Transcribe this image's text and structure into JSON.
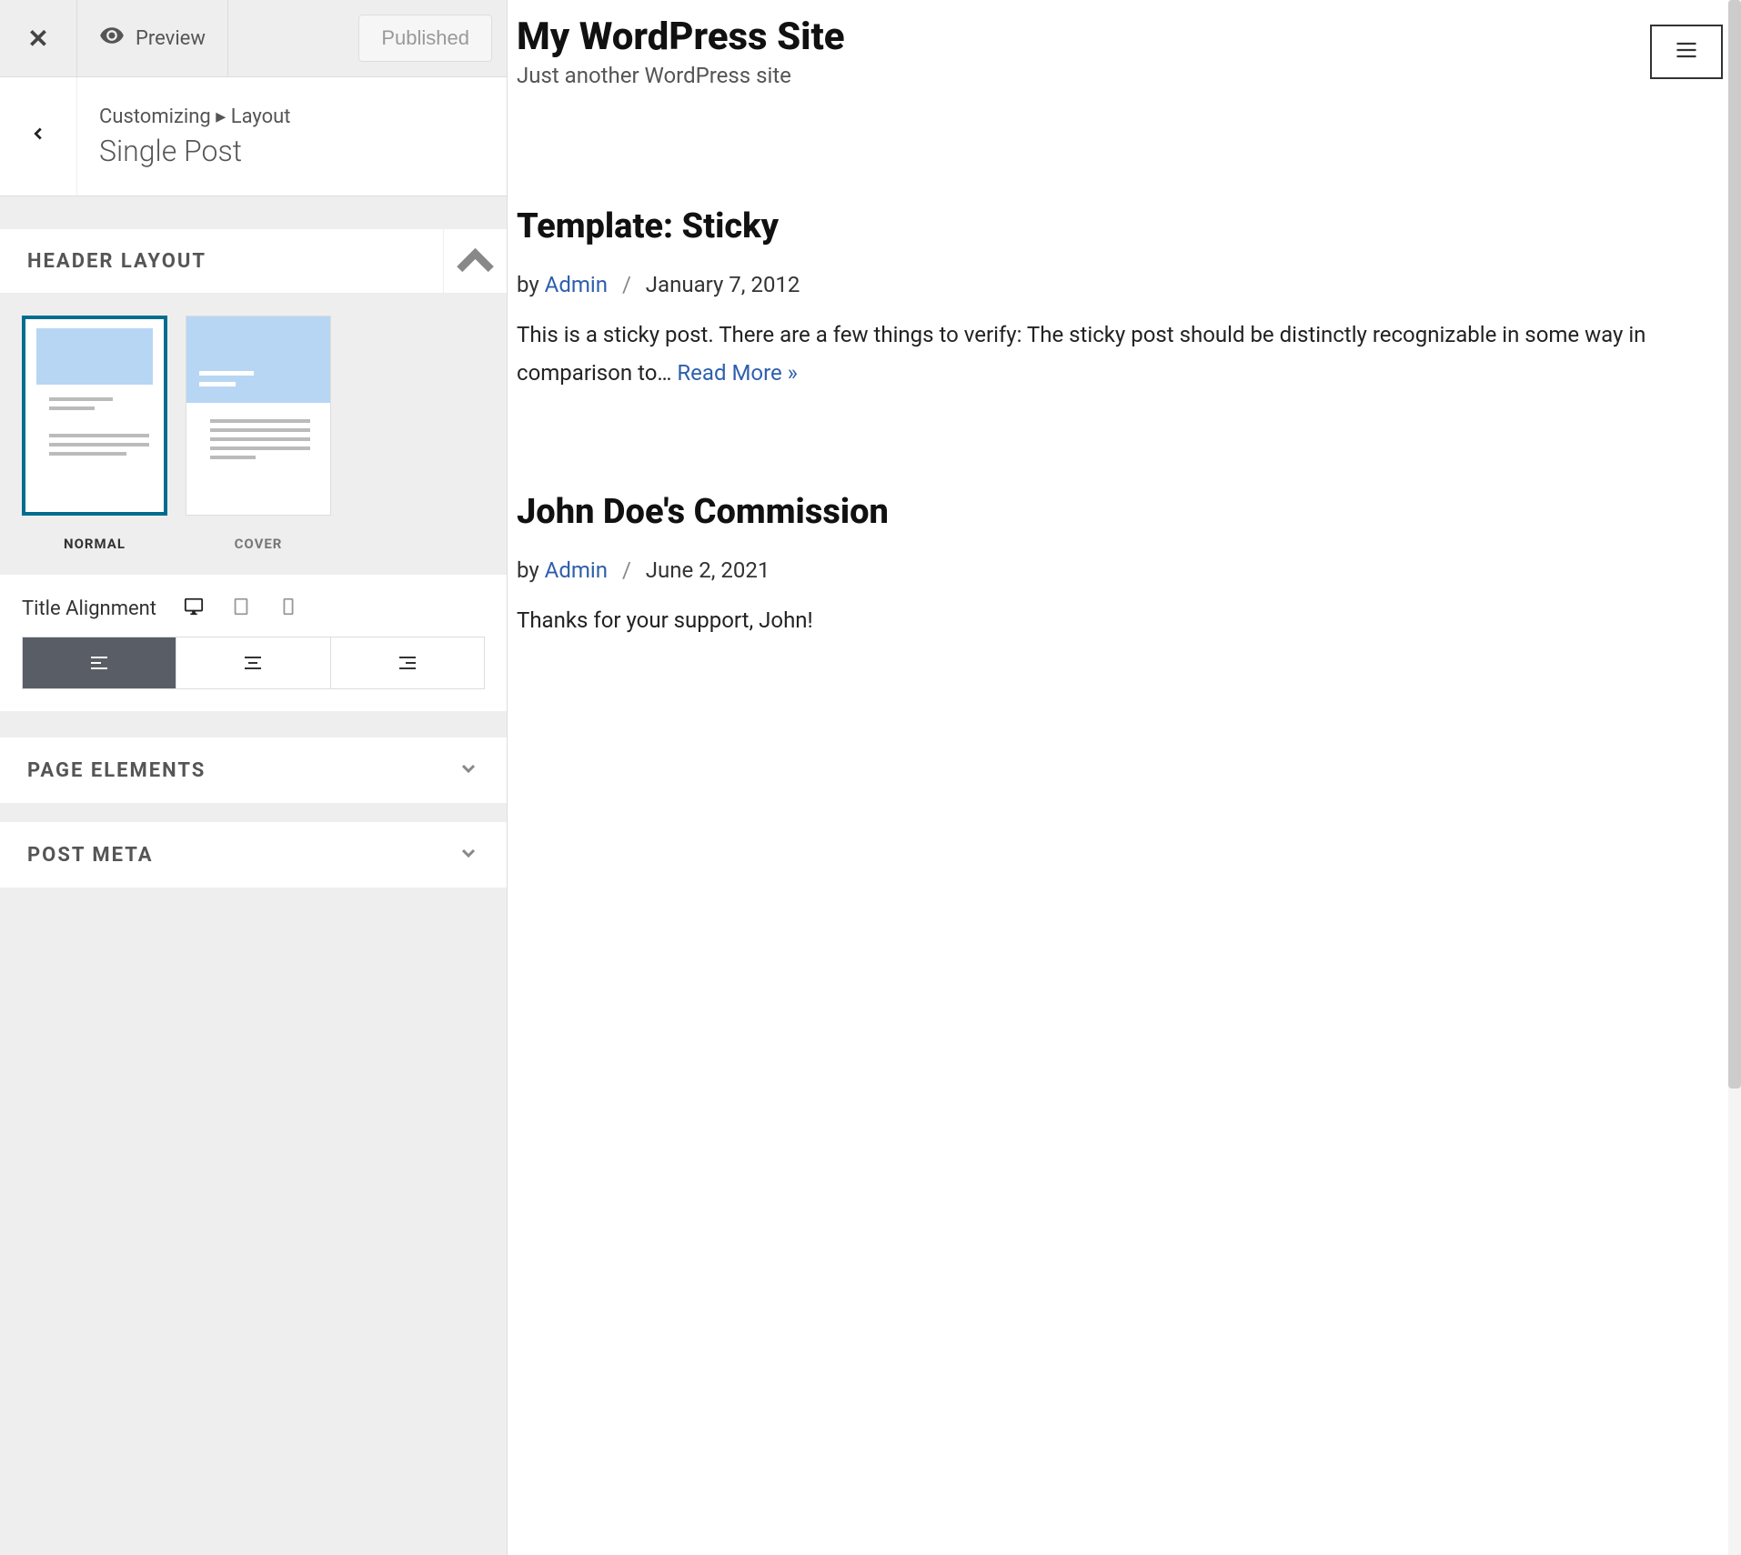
{
  "topBar": {
    "previewLabel": "Preview",
    "publishedLabel": "Published"
  },
  "breadcrumb": {
    "parent": "Customizing",
    "separator": "▸",
    "section": "Layout",
    "title": "Single Post"
  },
  "headerLayout": {
    "title": "HEADER LAYOUT",
    "options": [
      "NORMAL",
      "COVER"
    ],
    "selected": "NORMAL"
  },
  "titleAlignment": {
    "label": "Title Alignment",
    "devices": [
      "desktop",
      "tablet",
      "mobile"
    ],
    "activeDevice": "desktop",
    "options": [
      "left",
      "center",
      "right"
    ],
    "selected": "left"
  },
  "collapsedSections": [
    {
      "title": "PAGE ELEMENTS"
    },
    {
      "title": "POST META"
    }
  ],
  "preview": {
    "siteTitle": "My WordPress Site",
    "siteTagline": "Just another WordPress site",
    "posts": [
      {
        "title": "Template: Sticky",
        "authorLabel": "by ",
        "author": "Admin",
        "date": "January 7, 2012",
        "excerpt": "This is a sticky post. There are a few things to verify: The sticky post should be distinctly recognizable in some way in comparison to… ",
        "readMore": "Read More »"
      },
      {
        "title": "John Doe's Commission",
        "authorLabel": "by ",
        "author": "Admin",
        "date": "June 2, 2021",
        "excerpt": "Thanks for your support, John!",
        "readMore": ""
      }
    ]
  }
}
